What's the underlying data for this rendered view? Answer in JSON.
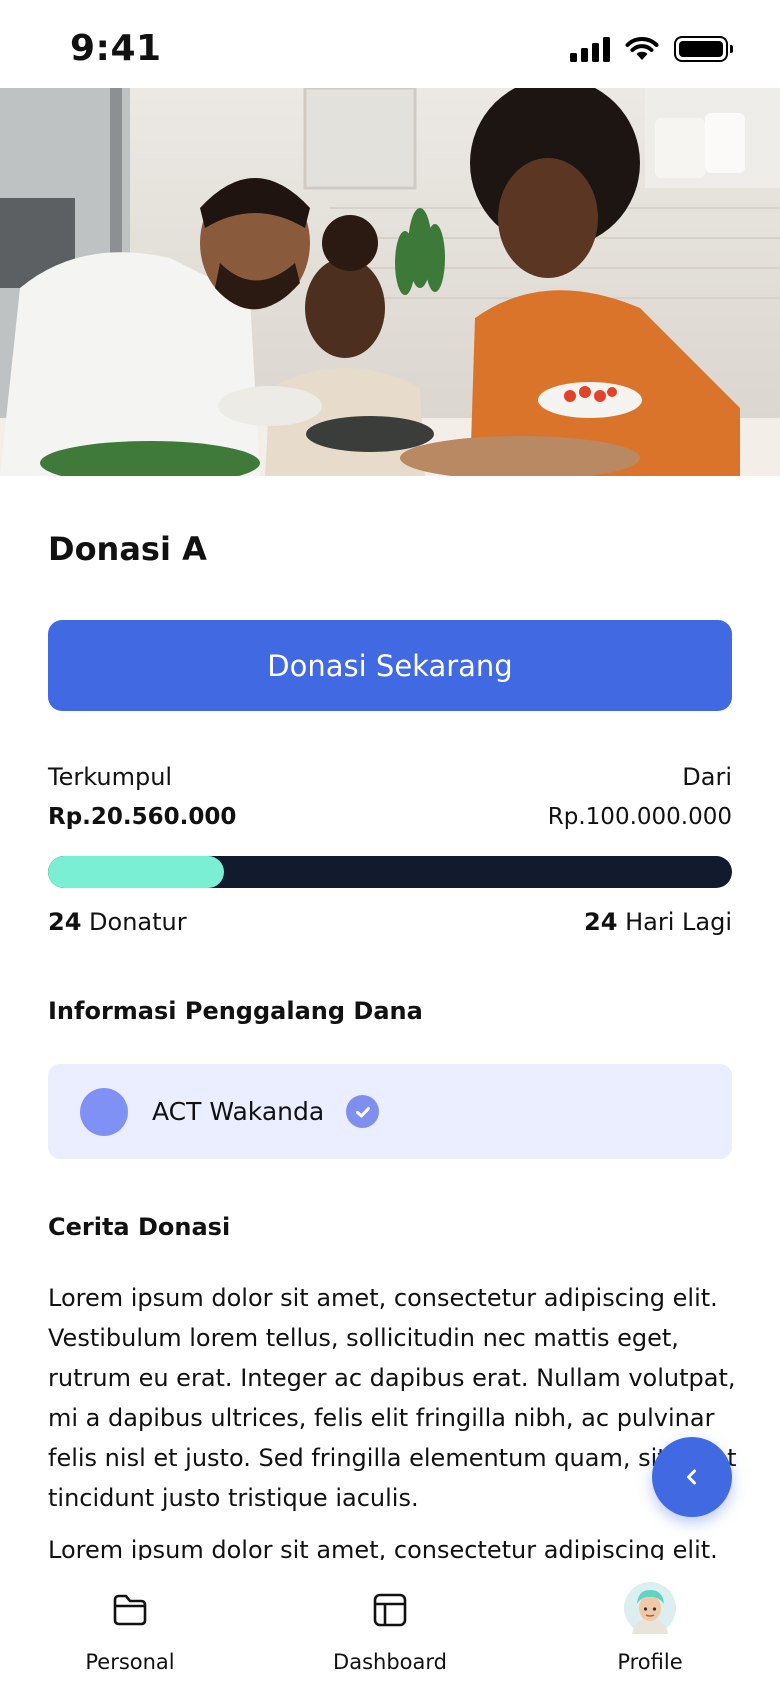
{
  "status_bar": {
    "time": "9:41"
  },
  "campaign": {
    "title": "Donasi A",
    "donate_button": "Donasi Sekarang",
    "collected_label": "Terkumpul",
    "collected_amount": "Rp.20.560.000",
    "target_label": "Dari",
    "target_amount": "Rp.100.000.000",
    "progress_fraction": 0.2056,
    "donors_count": "24",
    "donors_label": "Donatur",
    "days_count": "24",
    "days_label": "Hari Lagi"
  },
  "fundraiser": {
    "section_title": "Informasi Penggalang Dana",
    "name": "ACT Wakanda"
  },
  "story": {
    "section_title": "Cerita Donasi",
    "paragraph_1": "Lorem ipsum dolor sit amet, consectetur adipiscing elit. Vestibulum lorem tellus, sollicitudin nec mattis eget, rutrum eu erat. Integer ac dapibus erat. Nullam volutpat, mi a dapibus ultrices, felis elit fringilla nibh, ac pulvinar felis nisl et justo. Sed fringilla elementum quam, sit amet tincidunt justo tristique iaculis.",
    "paragraph_2": "Lorem ipsum dolor sit amet, consectetur adipiscing elit."
  },
  "bottom_nav": [
    {
      "label": "Personal",
      "icon": "folder-icon"
    },
    {
      "label": "Dashboard",
      "icon": "layout-icon"
    },
    {
      "label": "Profile",
      "icon": "avatar"
    }
  ],
  "colors": {
    "primary": "#4169E1",
    "progress_fill": "#7BEFD4",
    "progress_track": "#121A2E",
    "card_bg": "#EAEEFE"
  }
}
